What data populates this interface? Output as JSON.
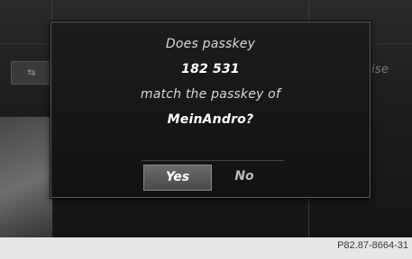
{
  "background": {
    "tab_symbol": "⇆",
    "partial_label": "ise"
  },
  "dialog": {
    "line1": "Does passkey",
    "passkey": "182 531",
    "line3": "match the passkey of",
    "device": "MeinAndro?"
  },
  "buttons": {
    "yes_label": "Yes",
    "no_label": "No",
    "selected": "Yes"
  },
  "caption": "P82.87-8664-31",
  "colors": {
    "screen_bg": "#1d1d1d",
    "dialog_border": "#5a5a5a",
    "selected_button": "#5a5a5a",
    "caption_bar": "#e6e6e6"
  }
}
